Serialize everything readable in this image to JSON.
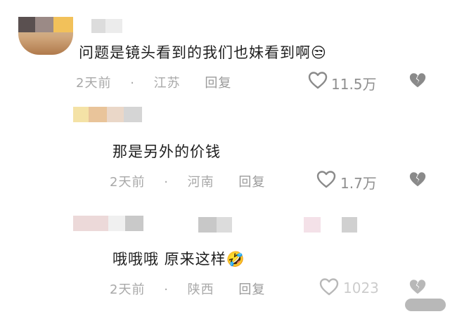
{
  "comments": [
    {
      "text": "问题是镜头看到的我们也妹看到啊",
      "emoji": "😒",
      "time": "2天前",
      "dot": "·",
      "location": "江苏",
      "reply": "回复",
      "likes": "11.5万"
    },
    {
      "text": "那是另外的价钱",
      "time": "2天前",
      "dot": "·",
      "location": "河南",
      "reply": "回复",
      "likes": "1.7万"
    },
    {
      "text": "哦哦哦 原来这样",
      "emoji": "🤣",
      "time": "2天前",
      "dot": "·",
      "location": "陕西",
      "reply": "回复",
      "likes": "1023"
    }
  ],
  "colors": {
    "meta_gray": "#a8a8a8",
    "icon_gray": "#8a8a8a"
  },
  "icons": [
    "heart-icon",
    "broken-heart-icon"
  ]
}
